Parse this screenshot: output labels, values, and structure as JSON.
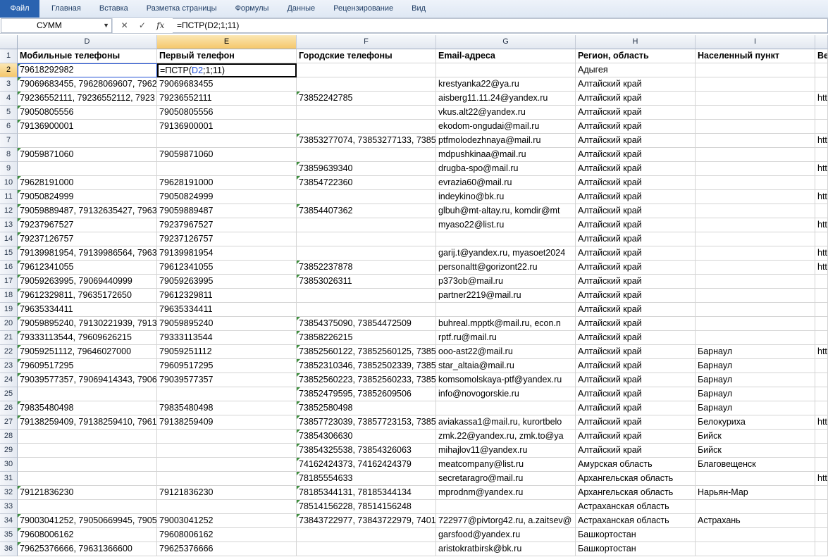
{
  "ribbon": {
    "file_label": "Файл",
    "tabs": [
      "Главная",
      "Вставка",
      "Разметка страницы",
      "Формулы",
      "Данные",
      "Рецензирование",
      "Вид"
    ]
  },
  "formula_bar": {
    "name_box": "СУММ",
    "cancel_symbol": "✕",
    "enter_symbol": "✓",
    "fx_label": "fx",
    "formula": "=ПСТР(D2;1;11)"
  },
  "active_cell": {
    "prefix": "=ПСТР(",
    "ref": "D2",
    "suffix": ";1;11)"
  },
  "columns": [
    "D",
    "E",
    "F",
    "G",
    "H",
    "I",
    ""
  ],
  "active_column": "E",
  "active_row": 2,
  "headers": [
    "Мобильные телефоны",
    "Первый телефон",
    "Городские телефоны",
    "Email-адреса",
    "Регион, область",
    "Населенный пункт",
    "Ве"
  ],
  "rows": [
    {
      "n": "2",
      "cells": [
        "79618292982",
        "",
        "",
        "",
        "Адыгея",
        "",
        ""
      ]
    },
    {
      "n": "3",
      "cells": [
        "79069683455, 79628069607, 7962",
        "79069683455",
        "",
        "krestyanka22@ya.ru",
        "Алтайский край",
        "",
        ""
      ]
    },
    {
      "n": "4",
      "cells": [
        "79236552111, 79236552112, 7923",
        "79236552111",
        "73852242785",
        "aisberg11.11.24@yandex.ru",
        "Алтайский край",
        "",
        "htt"
      ]
    },
    {
      "n": "5",
      "cells": [
        "79050805556",
        "79050805556",
        "",
        "vkus.alt22@yandex.ru",
        "Алтайский край",
        "",
        ""
      ]
    },
    {
      "n": "6",
      "cells": [
        "79136900001",
        "79136900001",
        "",
        "ekodom-ongudai@mail.ru",
        "Алтайский край",
        "",
        ""
      ]
    },
    {
      "n": "7",
      "cells": [
        "",
        "",
        "73853277074, 73853277133, 7385",
        "ptfmolodezhnaya@mail.ru",
        "Алтайский край",
        "",
        "htt"
      ]
    },
    {
      "n": "8",
      "cells": [
        "79059871060",
        "79059871060",
        "",
        "mdpushkinaa@mail.ru",
        "Алтайский край",
        "",
        ""
      ]
    },
    {
      "n": "9",
      "cells": [
        "",
        "",
        "73859639340",
        "drugba-spo@mail.ru",
        "Алтайский край",
        "",
        "htt"
      ]
    },
    {
      "n": "10",
      "cells": [
        "79628191000",
        "79628191000",
        "73854722360",
        "evrazia60@mail.ru",
        "Алтайский край",
        "",
        ""
      ]
    },
    {
      "n": "11",
      "cells": [
        "79050824999",
        "79050824999",
        "",
        "indeykino@bk.ru",
        "Алтайский край",
        "",
        "htt"
      ]
    },
    {
      "n": "12",
      "cells": [
        "79059889487, 79132635427, 7963",
        "79059889487",
        "73854407362",
        "glbuh@mt-altay.ru, komdir@mt",
        "Алтайский край",
        "",
        ""
      ]
    },
    {
      "n": "13",
      "cells": [
        "79237967527",
        "79237967527",
        "",
        "myaso22@list.ru",
        "Алтайский край",
        "",
        "htt"
      ]
    },
    {
      "n": "14",
      "cells": [
        "79237126757",
        "79237126757",
        "",
        "",
        "Алтайский край",
        "",
        ""
      ]
    },
    {
      "n": "15",
      "cells": [
        "79139981954, 79139986564, 7963",
        "79139981954",
        "",
        "garij.t@yandex.ru, myasoet2024",
        "Алтайский край",
        "",
        "htt"
      ]
    },
    {
      "n": "16",
      "cells": [
        "79612341055",
        "79612341055",
        "73852237878",
        "personaltt@gorizont22.ru",
        "Алтайский край",
        "",
        "htt"
      ]
    },
    {
      "n": "17",
      "cells": [
        "79059263995, 79069440999",
        "79059263995",
        "73853026311",
        "p373ob@mail.ru",
        "Алтайский край",
        "",
        ""
      ]
    },
    {
      "n": "18",
      "cells": [
        "79612329811, 79635172650",
        "79612329811",
        "",
        "partner2219@mail.ru",
        "Алтайский край",
        "",
        ""
      ]
    },
    {
      "n": "19",
      "cells": [
        "79635334411",
        "79635334411",
        "",
        "",
        "Алтайский край",
        "",
        ""
      ]
    },
    {
      "n": "20",
      "cells": [
        "79059895240, 79130221939, 7913",
        "79059895240",
        "73854375090, 73854472509",
        "buhreal.mpptk@mail.ru, econ.n",
        "Алтайский край",
        "",
        ""
      ]
    },
    {
      "n": "21",
      "cells": [
        "79333113544, 79609626215",
        "79333113544",
        "73858226215",
        "rptf.ru@mail.ru",
        "Алтайский край",
        "",
        ""
      ]
    },
    {
      "n": "22",
      "cells": [
        "79059251112, 79646027000",
        "79059251112",
        "73852560122, 73852560125, 7385",
        "ooo-ast22@mail.ru",
        "Алтайский край",
        "Барнаул",
        "htt"
      ]
    },
    {
      "n": "23",
      "cells": [
        "79609517295",
        "79609517295",
        "73852310346, 73852502339, 7385",
        "star_altaia@mail.ru",
        "Алтайский край",
        "Барнаул",
        ""
      ]
    },
    {
      "n": "24",
      "cells": [
        "79039577357, 79069414343, 7906",
        "79039577357",
        "73852560223, 73852560233, 7385",
        "komsomolskaya-ptf@yandex.ru",
        "Алтайский край",
        "Барнаул",
        ""
      ]
    },
    {
      "n": "25",
      "cells": [
        "",
        "",
        "73852479595, 73852609506",
        "info@novogorskie.ru",
        "Алтайский край",
        "Барнаул",
        ""
      ]
    },
    {
      "n": "26",
      "cells": [
        "79835480498",
        "79835480498",
        "73852580498",
        "",
        "Алтайский край",
        "Барнаул",
        ""
      ]
    },
    {
      "n": "27",
      "cells": [
        "79138259409, 79138259410, 7961",
        "79138259409",
        "73857723039, 73857723153, 7385",
        "aviakassa1@mail.ru, kurortbelo",
        "Алтайский край",
        "Белокуриха",
        "htt"
      ]
    },
    {
      "n": "28",
      "cells": [
        "",
        "",
        "73854306630",
        "zmk.22@yandex.ru, zmk.to@ya",
        "Алтайский край",
        "Бийск",
        ""
      ]
    },
    {
      "n": "29",
      "cells": [
        "",
        "",
        "73854325538, 73854326063",
        "mihajlov11@yandex.ru",
        "Алтайский край",
        "Бийск",
        ""
      ]
    },
    {
      "n": "30",
      "cells": [
        "",
        "",
        "74162424373, 74162424379",
        "meatcompany@list.ru",
        "Амурская область",
        "Благовещенск",
        ""
      ]
    },
    {
      "n": "31",
      "cells": [
        "",
        "",
        "78185554633",
        "secretaragro@mail.ru",
        "Архангельская область",
        "",
        "htt"
      ]
    },
    {
      "n": "32",
      "cells": [
        "79121836230",
        "79121836230",
        "78185344131, 78185344134",
        "mprodnm@yandex.ru",
        "Архангельская область",
        "Нарьян-Мар",
        ""
      ]
    },
    {
      "n": "33",
      "cells": [
        "",
        "",
        "78514156228, 78514156248",
        "",
        "Астраханская область",
        "",
        ""
      ]
    },
    {
      "n": "34",
      "cells": [
        "79003041252, 79050669945, 7905",
        "79003041252",
        "73843722977, 73843722979, 7401",
        "722977@pivtorg42.ru, a.zaitsev@",
        "Астраханская область",
        "Астрахань",
        ""
      ]
    },
    {
      "n": "35",
      "cells": [
        "79608006162",
        "79608006162",
        "",
        "garsfood@yandex.ru",
        "Башкортостан",
        "",
        ""
      ]
    },
    {
      "n": "36",
      "cells": [
        "79625376666, 79631366600",
        "79625376666",
        "",
        "aristokratbirsk@bk.ru",
        "Башкортостан",
        "",
        ""
      ]
    }
  ]
}
